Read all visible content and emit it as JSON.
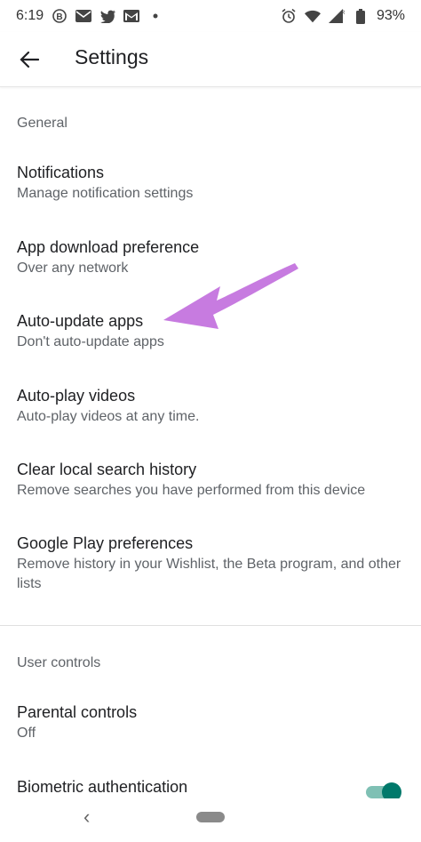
{
  "status_bar": {
    "time": "6:19",
    "battery": "93%"
  },
  "app_bar": {
    "title": "Settings"
  },
  "sections": {
    "general": "General",
    "user_controls": "User controls"
  },
  "items": [
    {
      "title": "Notifications",
      "subtitle": "Manage notification settings"
    },
    {
      "title": "App download preference",
      "subtitle": "Over any network"
    },
    {
      "title": "Auto-update apps",
      "subtitle": "Don't auto-update apps"
    },
    {
      "title": "Auto-play videos",
      "subtitle": "Auto-play videos at any time."
    },
    {
      "title": "Clear local search history",
      "subtitle": "Remove searches you have performed from this device"
    },
    {
      "title": "Google Play preferences",
      "subtitle": "Remove history in your Wishlist, the Beta program, and other lists"
    },
    {
      "title": "Parental controls",
      "subtitle": "Off"
    },
    {
      "title": "Biometric authentication",
      "subtitle": ""
    }
  ],
  "colors": {
    "accent": "#00796b",
    "annotation_arrow": "#c77be0"
  }
}
